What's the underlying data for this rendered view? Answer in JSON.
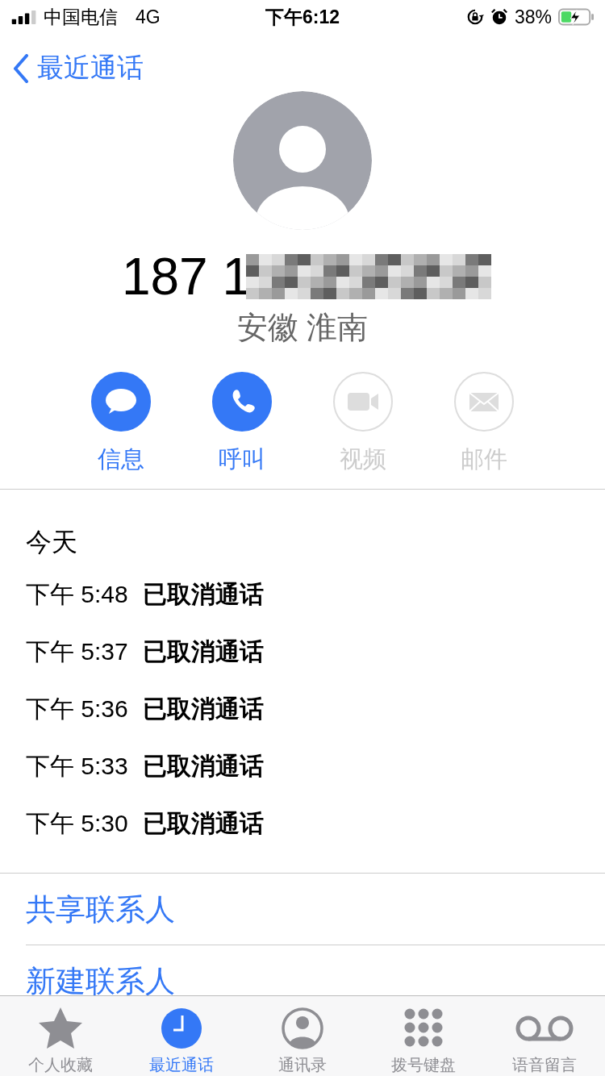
{
  "status_bar": {
    "carrier": "中国电信",
    "network": "4G",
    "time": "下午6:12",
    "battery_text": "38%",
    "battery": {
      "level": 0.38,
      "charging": true
    }
  },
  "nav": {
    "back_label": "最近通话"
  },
  "contact": {
    "number_visible": "187 1",
    "location": "安徽 淮南"
  },
  "actions": [
    {
      "kind": "message",
      "label": "信息",
      "disabled": false
    },
    {
      "kind": "call",
      "label": "呼叫",
      "disabled": false
    },
    {
      "kind": "video",
      "label": "视频",
      "disabled": true
    },
    {
      "kind": "mail",
      "label": "邮件",
      "disabled": true
    }
  ],
  "history": {
    "heading": "今天",
    "calls": [
      {
        "time": "下午 5:48",
        "status": "已取消通话"
      },
      {
        "time": "下午 5:37",
        "status": "已取消通话"
      },
      {
        "time": "下午 5:36",
        "status": "已取消通话"
      },
      {
        "time": "下午 5:33",
        "status": "已取消通话"
      },
      {
        "time": "下午 5:30",
        "status": "已取消通话"
      }
    ]
  },
  "links": [
    "共享联系人",
    "新建联系人"
  ],
  "tab_bar": [
    {
      "kind": "favorites",
      "label": "个人收藏",
      "selected": false
    },
    {
      "kind": "recents",
      "label": "最近通话",
      "selected": true
    },
    {
      "kind": "contacts",
      "label": "通讯录",
      "selected": false
    },
    {
      "kind": "keypad",
      "label": "拨号键盘",
      "selected": false
    },
    {
      "kind": "voicemail",
      "label": "语音留言",
      "selected": false
    }
  ]
}
